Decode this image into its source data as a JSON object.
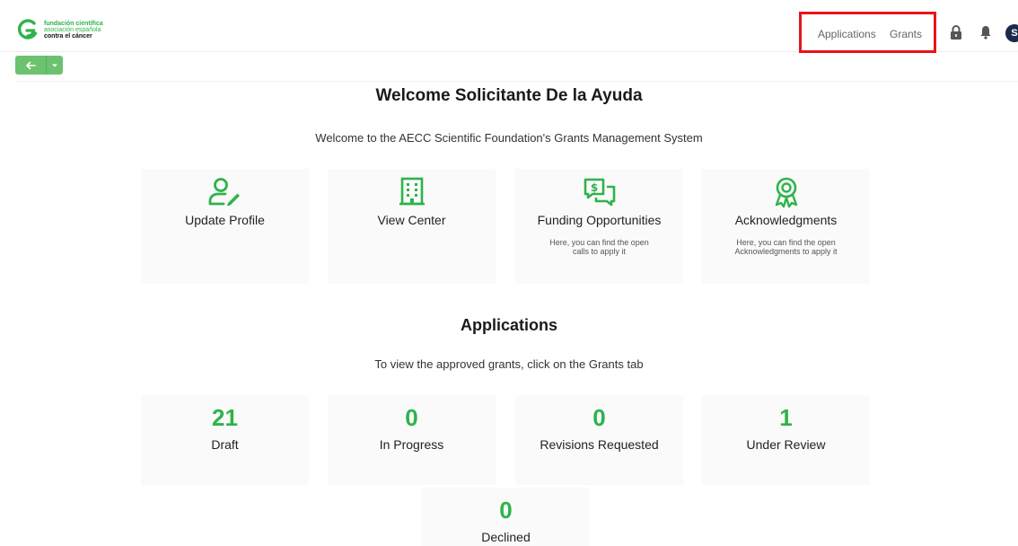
{
  "logo": {
    "line1": "fundación científica",
    "line2": "asociación española",
    "line3": "contra el cáncer"
  },
  "nav": {
    "applications": "Applications",
    "grants": "Grants"
  },
  "header_icons": {
    "lock": "lock-icon",
    "bell": "bell-icon",
    "avatar_initial": "S"
  },
  "colors": {
    "brand_green": "#2eb34b",
    "highlight_red": "#e8131b",
    "button_green": "#6cc26f"
  },
  "welcome": {
    "title": "Welcome Solicitante De la Ayuda",
    "subtitle": "Welcome to the AECC Scientific Foundation's Grants Management System"
  },
  "cards": [
    {
      "icon": "user-edit-icon",
      "title": "Update Profile",
      "desc": ""
    },
    {
      "icon": "building-icon",
      "title": "View Center",
      "desc": ""
    },
    {
      "icon": "money-chat-icon",
      "title": "Funding Opportunities",
      "desc": "Here, you can find the open calls to apply it"
    },
    {
      "icon": "award-icon",
      "title": "Acknowledgments",
      "desc": "Here, you can find the open Acknowledgments to apply it"
    }
  ],
  "applications": {
    "title": "Applications",
    "subtitle": "To view the approved grants, click on the Grants tab",
    "stats": [
      {
        "value": "21",
        "label": "Draft"
      },
      {
        "value": "0",
        "label": "In Progress"
      },
      {
        "value": "0",
        "label": "Revisions Requested"
      },
      {
        "value": "1",
        "label": "Under Review"
      },
      {
        "value": "0",
        "label": "Declined"
      }
    ]
  }
}
